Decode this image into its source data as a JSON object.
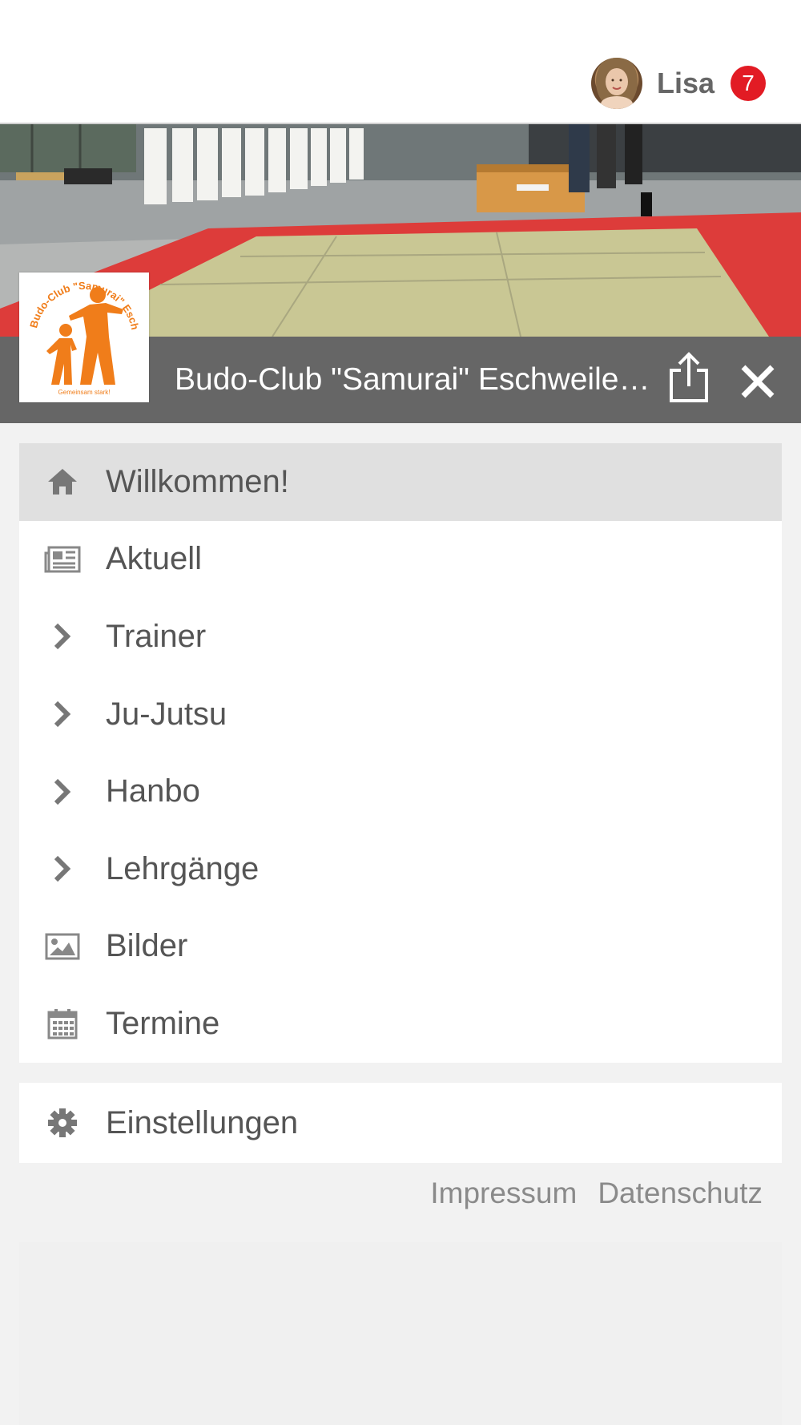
{
  "user": {
    "name": "Lisa",
    "notification_count": "7"
  },
  "club": {
    "title": "Budo-Club \"Samurai\" Eschweiler-Dürwiß",
    "logo_text": "Budo-Club \"Samurai\" Eschweiler-Dür"
  },
  "menu": {
    "items": [
      {
        "label": "Willkommen!",
        "icon": "home-icon",
        "active": true
      },
      {
        "label": "Aktuell",
        "icon": "newspaper-icon"
      },
      {
        "label": "Trainer",
        "icon": "chevron-right-icon"
      },
      {
        "label": "Ju-Jutsu",
        "icon": "chevron-right-icon"
      },
      {
        "label": "Hanbo",
        "icon": "chevron-right-icon"
      },
      {
        "label": "Lehrgänge",
        "icon": "chevron-right-icon"
      },
      {
        "label": "Bilder",
        "icon": "image-icon"
      },
      {
        "label": "Termine",
        "icon": "calendar-icon"
      }
    ]
  },
  "settings": {
    "label": "Einstellungen",
    "icon": "gear-icon"
  },
  "footer": {
    "impressum": "Impressum",
    "datenschutz": "Datenschutz"
  },
  "colors": {
    "badge": "#e21b24",
    "titlebar": "#666666",
    "logo_orange": "#f07d1a",
    "active_item": "#e0e0e0"
  }
}
